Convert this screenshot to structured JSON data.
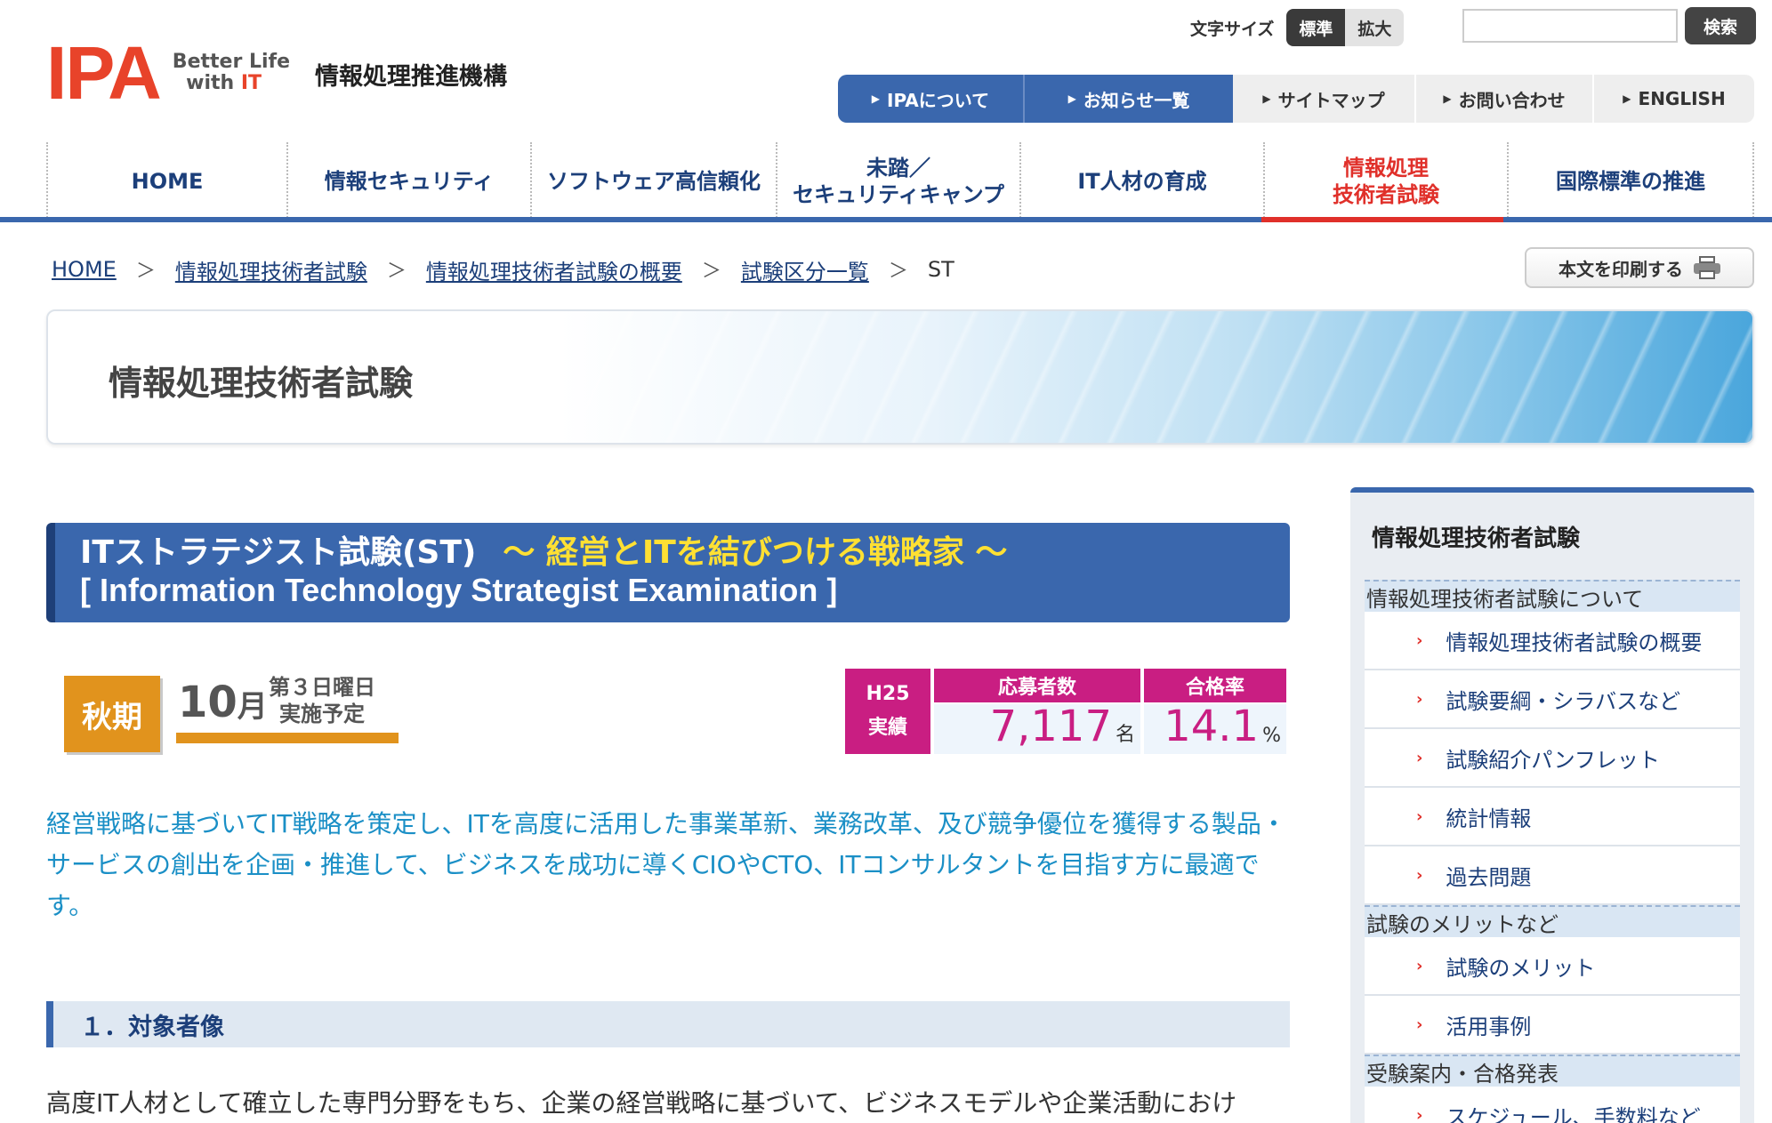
{
  "header": {
    "logo_text": "IPA",
    "logo_tag_line1": "Better Life",
    "logo_tag_with": "with",
    "logo_tag_it": "IT",
    "org_name": "情報処理推進機構",
    "font_size_label": "文字サイズ",
    "font_size_standard": "標準",
    "font_size_large": "拡大",
    "search_value": "",
    "search_button": "検索"
  },
  "util_nav": [
    {
      "label": "IPAについて"
    },
    {
      "label": "お知らせ一覧"
    },
    {
      "label": "サイトマップ"
    },
    {
      "label": "お問い合わせ"
    },
    {
      "label": "ENGLISH"
    }
  ],
  "global_nav": [
    {
      "label": "HOME"
    },
    {
      "label": "情報セキュリティ"
    },
    {
      "label": "ソフトウェア高信頼化"
    },
    {
      "label": "未踏／\nセキュリティキャンプ"
    },
    {
      "label": "IT人材の育成"
    },
    {
      "label": "情報処理\n技術者試験"
    },
    {
      "label": "国際標準の推進"
    }
  ],
  "breadcrumb": [
    {
      "label": "HOME"
    },
    {
      "label": "情報処理技術者試験"
    },
    {
      "label": "情報処理技術者試験の概要"
    },
    {
      "label": "試験区分一覧"
    },
    {
      "label": "ST"
    }
  ],
  "print_button": "本文を印刷する",
  "hero_title": "情報処理技術者試験",
  "exam": {
    "title": "ITストラテジスト試験(ST)",
    "subtitle": "～ 経営とITを結びつける戦略家 ～",
    "title_en": "[ Information Technology Strategist Examination ]",
    "season": "秋期",
    "month_num": "10",
    "month_unit": "月",
    "schedule_line1": "第３日曜日",
    "schedule_line2": "実施予定",
    "stats_year": "H25",
    "stats_year_sub": "実績",
    "applicants_label": "応募者数",
    "applicants_value": "7,117",
    "applicants_unit": "名",
    "pass_rate_label": "合格率",
    "pass_rate_value": "14.1",
    "pass_rate_unit": "%",
    "lead": "経営戦略に基づいてIT戦略を策定し、ITを高度に活用した事業革新、業務改革、及び競争優位を獲得する製品・サービスの創出を企画・推進して、ビジネスを成功に導くCIOやCTO、ITコンサルタントを目指す方に最適です。",
    "section1_title": "１．対象者像",
    "section1_body": "高度IT人材として確立した専門分野をもち、企業の経営戦略に基づいて、ビジネスモデルや企業活動におけ"
  },
  "sidebar": {
    "title": "情報処理技術者試験",
    "cat1": "情報処理技術者試験について",
    "cat1_links": [
      {
        "label": "情報処理技術者試験の概要"
      },
      {
        "label": "試験要綱・シラバスなど"
      },
      {
        "label": "試験紹介パンフレット"
      },
      {
        "label": "統計情報"
      },
      {
        "label": "過去問題"
      }
    ],
    "cat2": "試験のメリットなど",
    "cat2_links": [
      {
        "label": "試験のメリット"
      },
      {
        "label": "活用事例"
      }
    ],
    "cat3": "受験案内・合格発表",
    "cat3_links": [
      {
        "label": "スケジュール、手数料など"
      }
    ]
  },
  "colors": {
    "brand_red": "#e8432a",
    "nav_blue": "#3a67ad",
    "accent_magenta": "#c91e82",
    "accent_orange": "#e1931d",
    "lead_text": "#1a8fc6"
  }
}
